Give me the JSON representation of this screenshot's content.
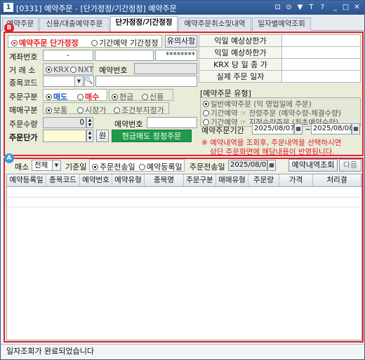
{
  "window": {
    "number": "1",
    "title": "[0331] 예약주문 - [단가정정/기간정정] 예약주문",
    "controls": [
      "⊡",
      "⊙",
      "▼",
      "T",
      "?",
      "_",
      "□",
      "✕"
    ]
  },
  "tabs": [
    {
      "label": "예약주문"
    },
    {
      "label": "신용/대출예약주문"
    },
    {
      "label": "단가정정/기간정정",
      "active": true
    },
    {
      "label": "예약주문취소및내역"
    },
    {
      "label": "일자별예약조회"
    }
  ],
  "badges": {
    "b": "B",
    "a": "A"
  },
  "order_type": {
    "option1": "예약주문 단가정정",
    "option2": "기간예약 기간정정",
    "notice_btn": "유의사항"
  },
  "form": {
    "account_label": "계좌번호",
    "account_value": "-",
    "password_mask": "********",
    "exchange_label": "거 래 소",
    "exchange_krx": "KRX",
    "exchange_nxt": "NXT",
    "reservation_no_label": "예약번호",
    "item_code_label": "종목코드",
    "order_class_label": "주문구분",
    "sell": "매도",
    "buy": "매수",
    "cash": "현금",
    "credit": "신용",
    "trade_class_label": "매매구분",
    "normal": "보통",
    "market": "시장가",
    "conditional": "조건부지정가",
    "qty_label": "주문수량",
    "qty_value": "0",
    "reservation_no_label2": "예약번호",
    "price_label": "주문단가",
    "won": "원",
    "submit_btn": "현금매도 정정주문"
  },
  "info_table": [
    {
      "label": "익일 예상상한가",
      "value": ""
    },
    {
      "label": "익일 예상하한가",
      "value": ""
    },
    {
      "label": "KRX 당 일 종 가",
      "value": ""
    },
    {
      "label": "실제 주문 일자",
      "value": ""
    }
  ],
  "reservation_type": {
    "title": "[예약주문 유형]",
    "opt1": "일반예약주문 (익 영업일에 주문)",
    "opt2": "기간예약 ☞ 잔량주문 (예약수량-체결수량)",
    "opt3": "기간예약 ☞ 지정수량주문 (최초예약수량)"
  },
  "period": {
    "label": "예약주문기간",
    "start": "2025/08/07",
    "end": "2025/08/08",
    "tilde": "~"
  },
  "notice": {
    "line1": "※ 예약내역을 조회후, 주문내역을 선택하시면",
    "line2": "상단 주문화면에 해당내용이 반영됩니다."
  },
  "filter": {
    "market_label": "매소",
    "market_value": "전체",
    "basis_label": "기준일",
    "basis_opt1": "주문전송일",
    "basis_opt2": "예약등록일",
    "date_label": "주문전송일",
    "date_value": "2025/08/07",
    "query_btn": "예약내역조회",
    "next_btn": "다음"
  },
  "grid_columns": [
    "예약등록일",
    "종목코드",
    "예약번호",
    "예약유형",
    "종목명",
    "주문구분",
    "매매유형",
    "주문량",
    "가격",
    "처리결"
  ],
  "status_text": "일자조회가 완료되었습니다",
  "colors": {
    "highlight_border": "#e0202a",
    "badge_b": "#e0202a",
    "badge_a": "#3a9bd6",
    "submit_btn": "#1f9a4a",
    "titlebar": "#2b528c"
  }
}
